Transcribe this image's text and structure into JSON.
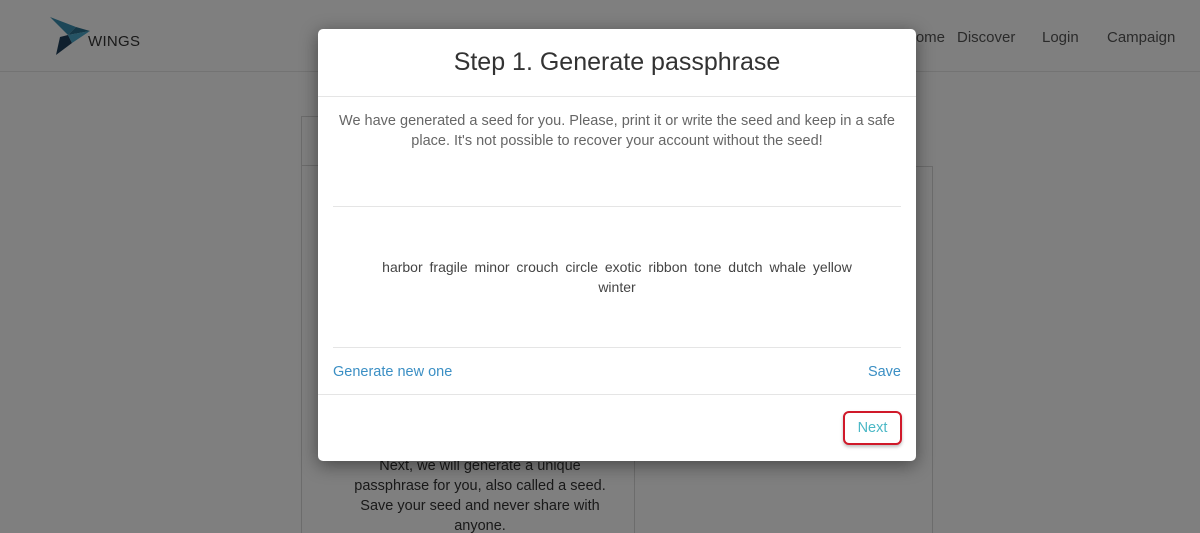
{
  "header": {
    "logo_text": "WINGS",
    "nav": [
      {
        "label": "Home"
      },
      {
        "label": "Discover"
      },
      {
        "label": "Login"
      },
      {
        "label": "Campaign"
      }
    ]
  },
  "background": {
    "info_text": "Next, we will generate a unique passphrase for you, also called a seed. Save your seed and never share with anyone."
  },
  "modal": {
    "title": "Step 1. Generate passphrase",
    "intro": "We have generated a seed for you. Please, print it or write the seed and keep in a safe place. It's not possible to recover your account without the seed!",
    "seed": "harbor fragile minor crouch circle exotic ribbon tone dutch whale yellow winter",
    "generate_label": "Generate new one",
    "save_label": "Save",
    "next_label": "Next"
  },
  "colors": {
    "link": "#3b8fc4",
    "next_text": "#4bb8c6",
    "highlight_border": "#d0192a",
    "backdrop": "rgba(0,0,0,0.5)"
  }
}
